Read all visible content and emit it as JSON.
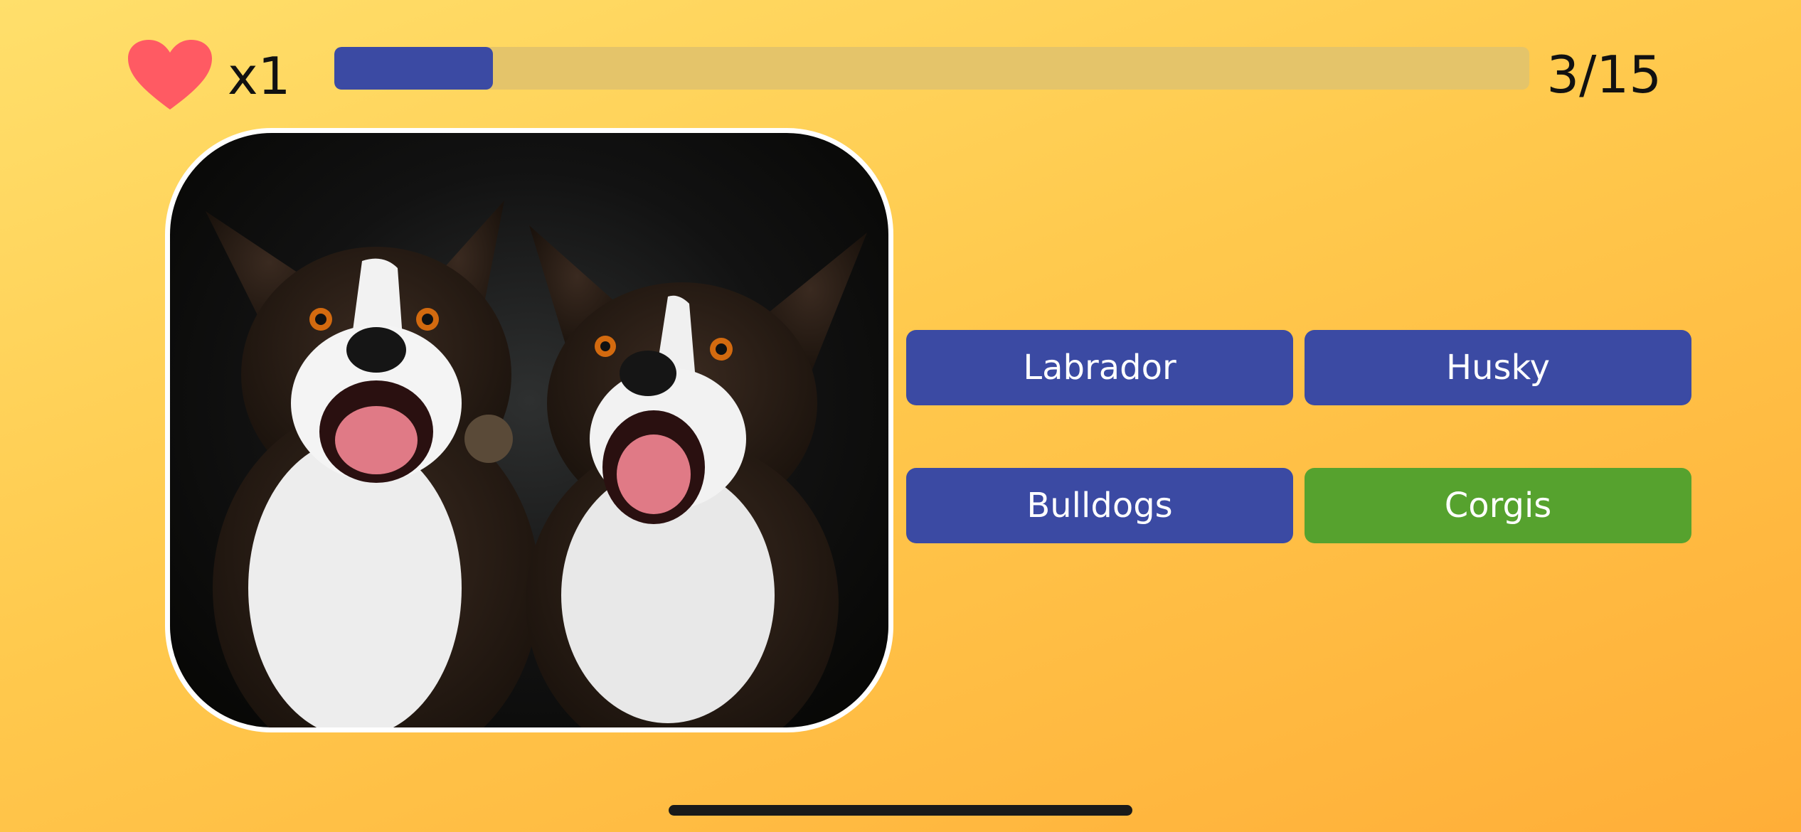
{
  "status_bar": {
    "lives_icon": "heart-icon",
    "lives_text": "x1",
    "progress": {
      "current": 3,
      "total": 15,
      "fraction": 0.133
    },
    "counter_text": "3/15"
  },
  "question": {
    "image_subject": "two corgi dogs with open mouths on a dark background"
  },
  "answers": [
    {
      "label": "Labrador",
      "state": "default"
    },
    {
      "label": "Husky",
      "state": "default"
    },
    {
      "label": "Bulldogs",
      "state": "default"
    },
    {
      "label": "Corgis",
      "state": "correct"
    }
  ],
  "colors": {
    "button_default": "#3b4aa3",
    "button_correct": "#56a22e",
    "heart": "#ff5a63",
    "progress_fill": "#3b4aa3",
    "progress_track": "#e4c46a"
  }
}
